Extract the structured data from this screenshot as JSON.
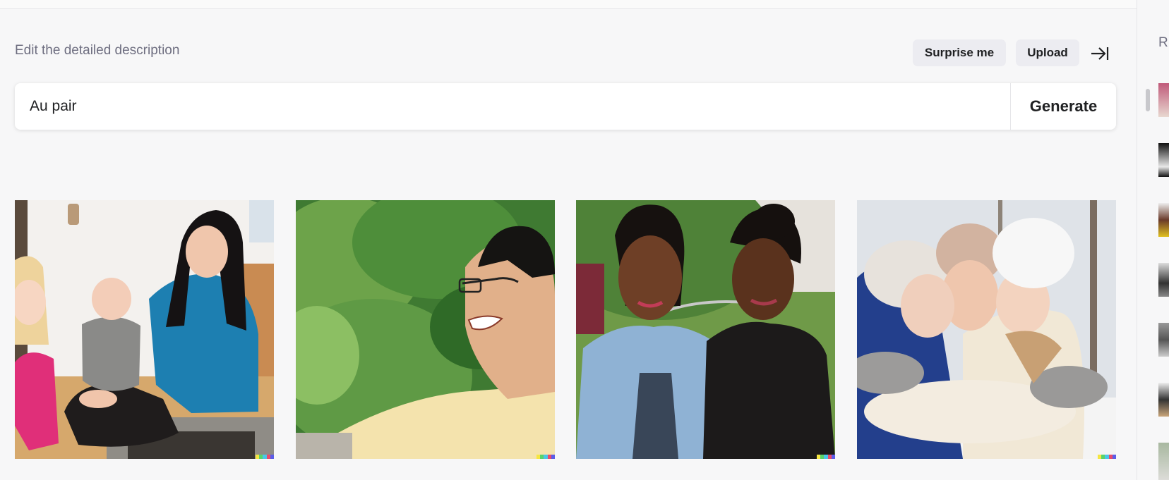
{
  "editor": {
    "heading": "Edit the detailed description",
    "surprise_label": "Surprise me",
    "upload_label": "Upload",
    "collapse_icon": "arrow-right-to-bar-icon",
    "prompt_value": "Au pair",
    "generate_label": "Generate"
  },
  "results": {
    "images": [
      {
        "subject": "woman with baby and toddler indoors"
      },
      {
        "subject": "laughing man with glasses outdoors"
      },
      {
        "subject": "two smiling women in garden"
      },
      {
        "subject": "woman hugging two children in snow"
      }
    ],
    "watermark_colors": [
      "#f5e642",
      "#59d36b",
      "#4bc5e8",
      "#e84b6c",
      "#5b5ee8"
    ]
  },
  "sidebar": {
    "title": "R"
  }
}
